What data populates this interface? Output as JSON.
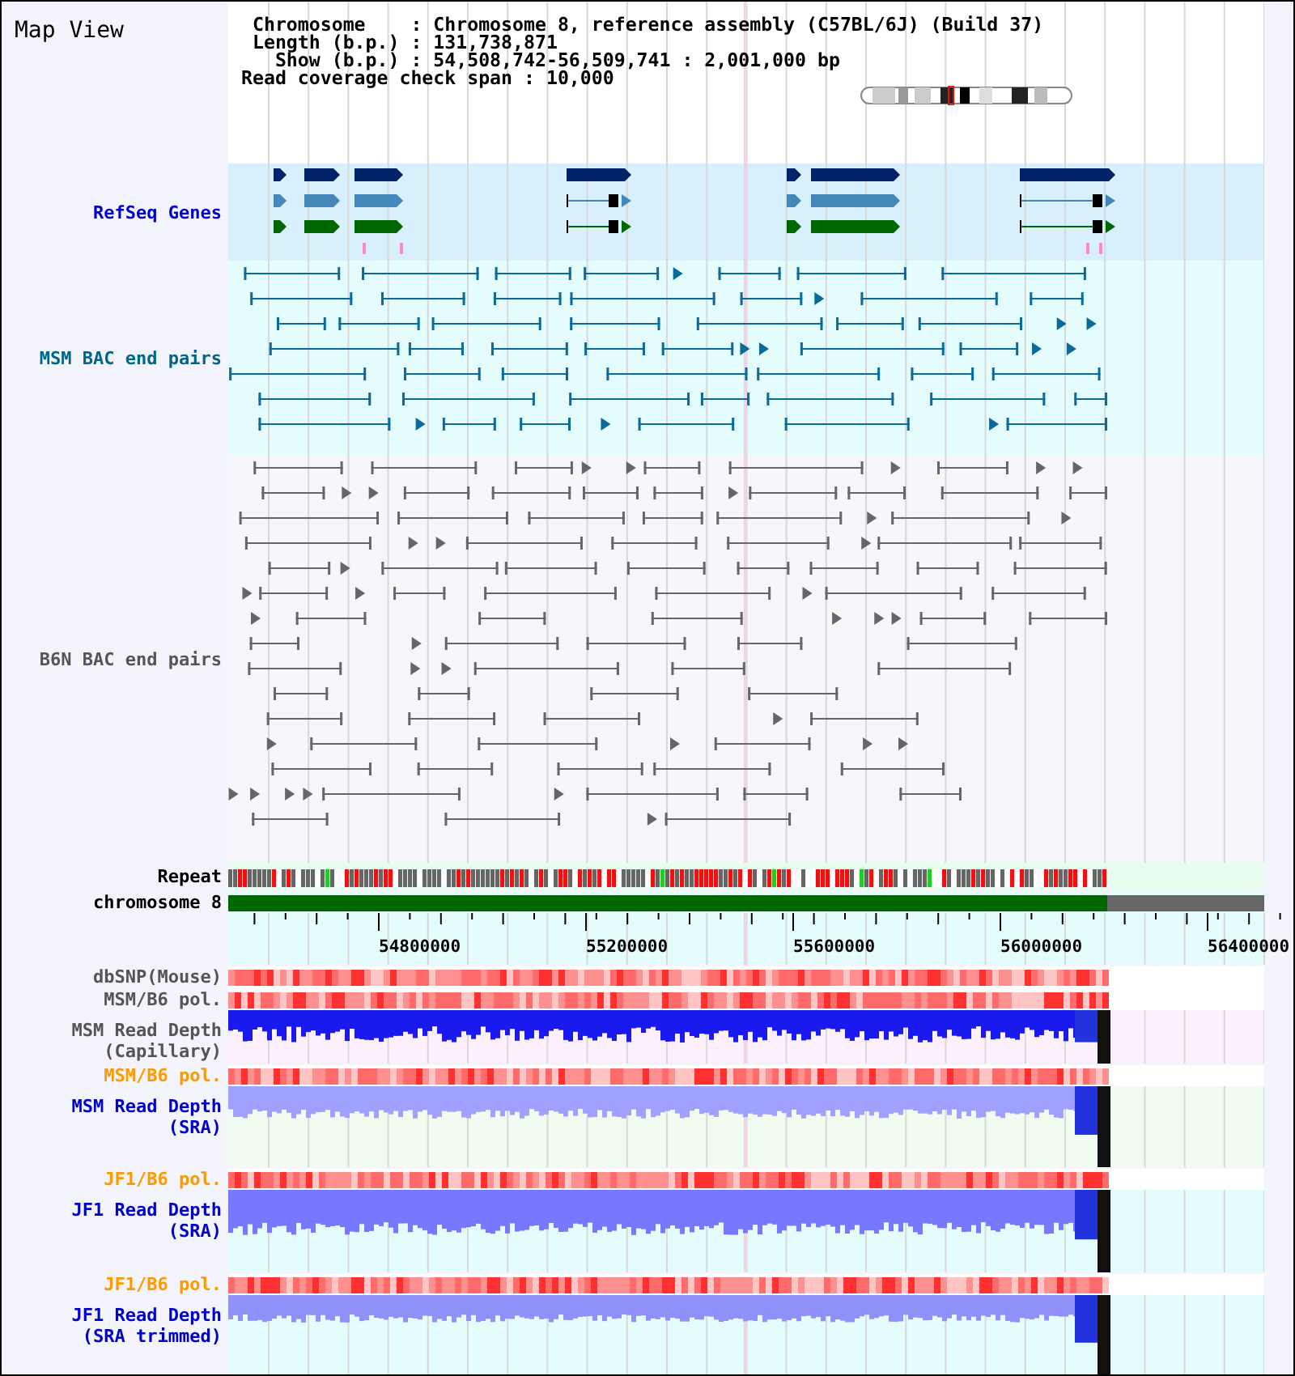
{
  "title": "Map View",
  "info": [
    " Chromosome    : Chromosome 8, reference assembly (C57BL/6J) (Build 37)",
    " Length (b.p.) : 131,738,871",
    "   Show (b.p.) : 54,508,742-56,509,741 : 2,001,000 bp",
    "Read coverage check span : 10,000"
  ],
  "tracks": [
    {
      "kind": "genes",
      "label": [
        "RefSeq Genes"
      ],
      "color": "#0000cc"
    },
    {
      "kind": "msm-pairs",
      "label": [
        "MSM BAC end pairs"
      ],
      "color": "#006688"
    },
    {
      "kind": "b6n-pairs",
      "label": [
        "B6N BAC end pairs"
      ],
      "color": "#555555"
    },
    {
      "kind": "repeat",
      "label": [
        "Repeat"
      ],
      "color": "#000000"
    },
    {
      "kind": "chromosome",
      "label": [
        "chromosome 8"
      ],
      "color": "#000000"
    },
    {
      "kind": "axis",
      "ticks": [
        "54800000",
        "55200000",
        "55600000",
        "56000000",
        "56400000"
      ]
    },
    {
      "kind": "heat",
      "label": [
        "dbSNP(Mouse)"
      ],
      "color": "#555555"
    },
    {
      "kind": "heat",
      "label": [
        "MSM/B6 pol."
      ],
      "color": "#555555"
    },
    {
      "kind": "capillary-depth",
      "label": [
        "MSM Read Depth",
        "(Capillary)"
      ],
      "color": "#555555"
    },
    {
      "kind": "heat",
      "label": [
        "MSM/B6 pol."
      ],
      "color": "#ff9900"
    },
    {
      "kind": "sra-depth",
      "label": [
        "MSM Read Depth",
        "(SRA)"
      ],
      "color": "#0000cc"
    },
    {
      "kind": "heat",
      "label": [
        "JF1/B6 pol."
      ],
      "color": "#ff9900"
    },
    {
      "kind": "jf1-depth",
      "label": [
        "JF1 Read Depth",
        "(SRA)"
      ],
      "color": "#0000cc"
    },
    {
      "kind": "heat",
      "label": [
        "JF1/B6 pol."
      ],
      "color": "#ff9900"
    },
    {
      "kind": "trimmed-depth",
      "label": [
        "JF1 Read Depth",
        "(SRA trimmed)"
      ],
      "color": "#0000cc"
    }
  ]
}
